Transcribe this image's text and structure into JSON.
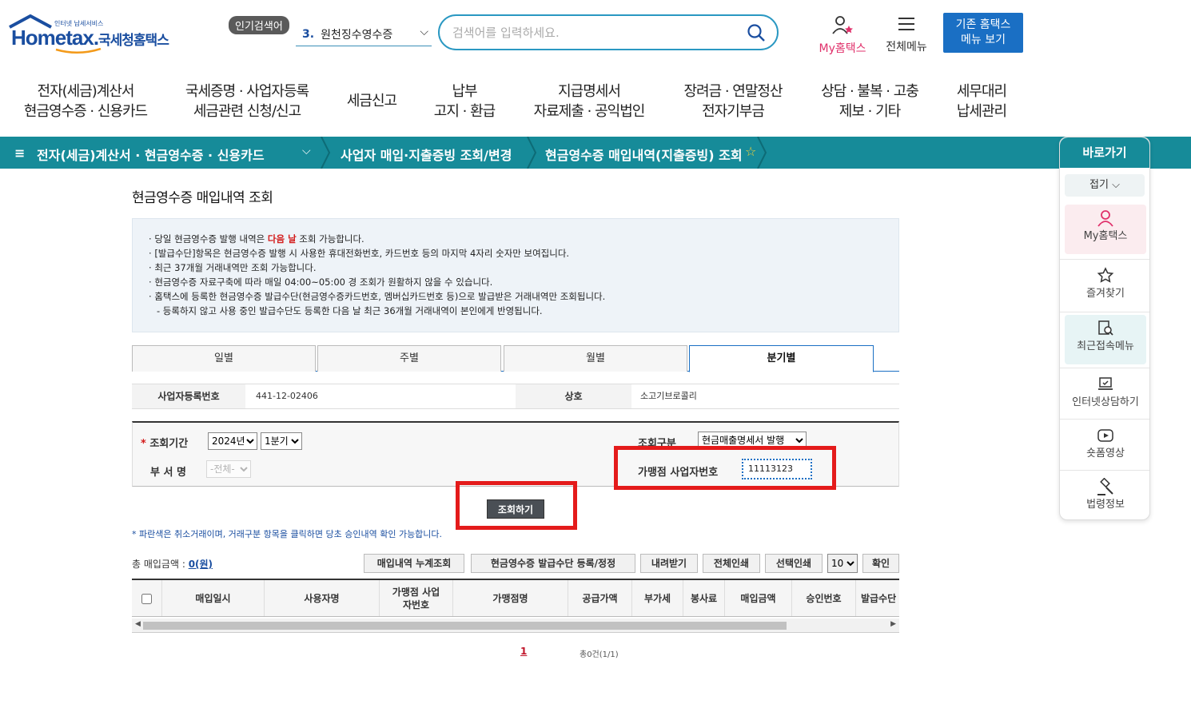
{
  "header": {
    "logo_sub": "인터넷 납세서비스",
    "logo_word": "Hometax.",
    "logo_kname": "국세청홈택스",
    "popular_badge": "인기검색어",
    "popular_rank": "3.",
    "popular_text": "원천징수영수증",
    "search_placeholder": "검색어를 입력하세요.",
    "my_home": "My홈택스",
    "all_menu": "전체메뉴",
    "old_home_line1": "기존 홈택스",
    "old_home_line2": "메뉴 보기"
  },
  "topnav": [
    {
      "line1": "전자(세금)계산서",
      "line2": "현금영수증 · 신용카드"
    },
    {
      "line1": "국세증명 · 사업자등록",
      "line2": "세금관련 신청/신고"
    },
    {
      "line1": "세금신고",
      "line2": ""
    },
    {
      "line1": "납부",
      "line2": "고지 · 환급"
    },
    {
      "line1": "지급명세서",
      "line2": "자료제출 · 공익법인"
    },
    {
      "line1": "장려금 · 연말정산",
      "line2": "전자기부금"
    },
    {
      "line1": "상담 · 불복 · 고충",
      "line2": "제보 · 기타"
    },
    {
      "line1": "세무대리",
      "line2": "납세관리"
    }
  ],
  "breadcrumb": {
    "level1": "전자(세금)계산서 · 현금영수증 · 신용카드",
    "level2": "사업자 매입·지출증빙 조회/변경",
    "level3": "현금영수증 매입내역(지출증빙) 조회"
  },
  "quick": {
    "title": "바로가기",
    "fold": "접기",
    "items": [
      "My홈택스",
      "즐겨찾기",
      "최근접속메뉴",
      "인터넷상담하기",
      "숏폼영상",
      "법령정보"
    ]
  },
  "page": {
    "title": "현금영수증 매입내역 조회",
    "notice": {
      "l1_pre": "당일 현금영수증 발행 내역은 ",
      "l1_hl": "다음 날",
      "l1_post": " 조회 가능합니다.",
      "l2": "[발급수단]항목은 현금영수증 발행 시 사용한 휴대전화번호, 카드번호 등의 마지막 4자리 숫자만 보여집니다.",
      "l3": "최근 37개월 거래내역만 조회 가능합니다.",
      "l4": "현금영수증 자료구축에 따라 매일 04:00~05:00 경 조회가 원활하지 않을 수 있습니다.",
      "l5": "홈택스에 등록한 현금영수증 발급수단(현금영수증카드번호, 멤버십카드번호 등)으로 발급받은 거래내역만 조회됩니다.",
      "l6": "- 등록하지 않고 사용 중인 발급수단도 등록한 다음 날 최근 36개월 거래내역이 본인에게 반영됩니다."
    },
    "tabs": [
      "일별",
      "주별",
      "월별",
      "분기별"
    ],
    "active_tab": "분기별",
    "biz_no_label": "사업자등록번호",
    "biz_no_value": "441-12-02406",
    "company_label": "상호",
    "company_value": "소고기브로콜리",
    "filter": {
      "period_label": "조회기간",
      "year": "2024년",
      "quarter": "1분기",
      "dept_label": "부 서 명",
      "dept_value": "-전체-",
      "type_label": "조회구분",
      "type_value": "현금매출명세서 발행",
      "merchant_label": "가맹점 사업자번호",
      "merchant_value": "11113123"
    },
    "search_button": "조회하기",
    "note": "* 파란색은 취소거래이며, 거래구분 항목을 클릭하면 당초 승인내역 확인 가능합니다.",
    "total_label": "총 매입금액 : ",
    "total_value": "0(원)",
    "actions": [
      "매입내역 누계조회",
      "현금영수증 발급수단 등록/정정",
      "내려받기",
      "전체인쇄",
      "선택인쇄"
    ],
    "page_size": "10",
    "confirm": "확인",
    "columns": [
      "매입일시",
      "사용자명",
      "가맹점 사업자번호",
      "가맹점명",
      "공급가액",
      "부가세",
      "봉사료",
      "매입금액",
      "승인번호",
      "발급수단"
    ],
    "pager_current": "1",
    "count_text": "총0건(1/1)"
  },
  "colors": {
    "accent_teal": "#168b99",
    "brand_blue": "#1a4ea0",
    "highlight_red": "#e41b1b"
  }
}
